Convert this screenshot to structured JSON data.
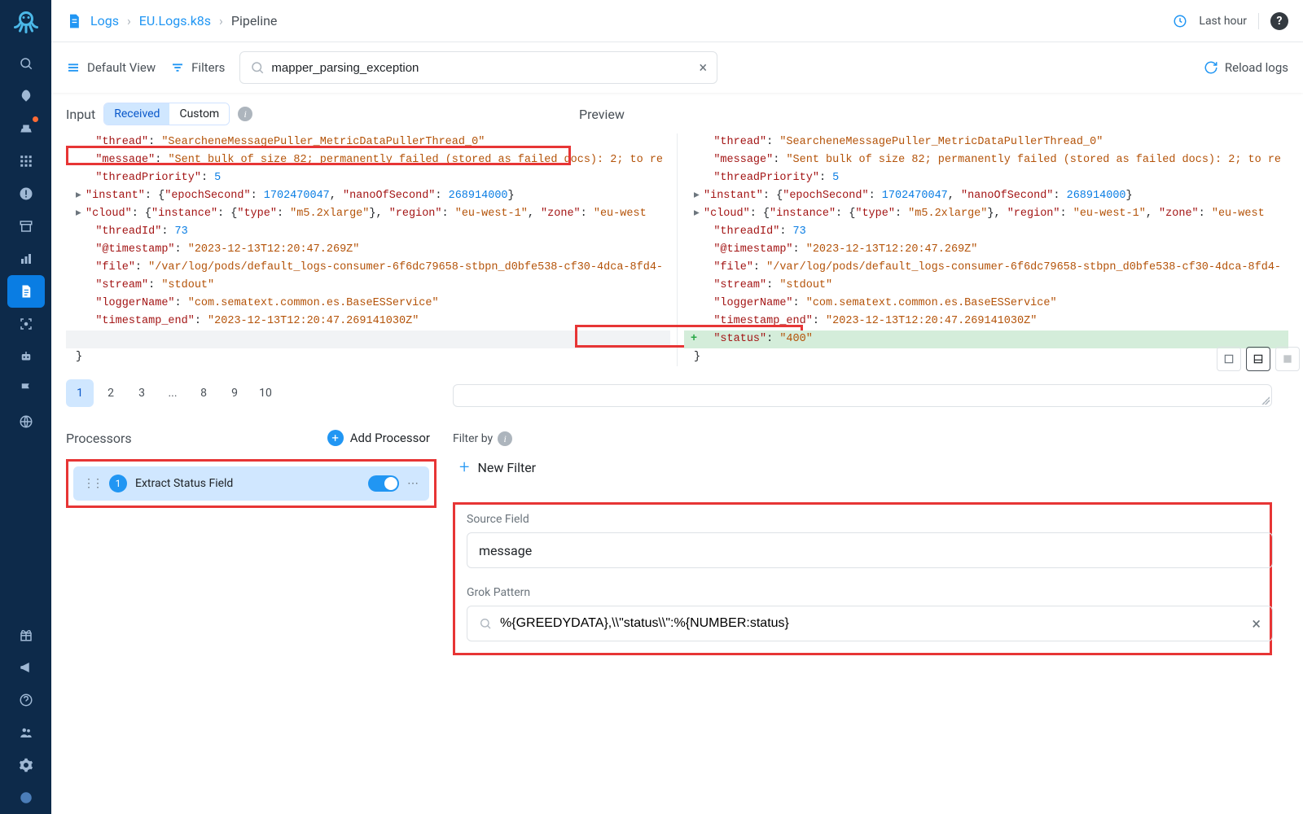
{
  "breadcrumbs": {
    "root": "Logs",
    "app": "EU.Logs.k8s",
    "tab": "Pipeline",
    "time": "Last hour"
  },
  "toolbar": {
    "default_view": "Default View",
    "filters": "Filters",
    "search_value": "mapper_parsing_exception",
    "reload": "Reload logs"
  },
  "panes": {
    "input_title": "Input",
    "received": "Received",
    "custom": "Custom",
    "preview_title": "Preview"
  },
  "json_lines": {
    "thread_key": "\"thread\"",
    "thread_val": "\"SearcheneMessagePuller_MetricDataPullerThread_0\"",
    "message_key": "\"message\"",
    "message_val_left": "\"Sent bulk of size 82; permanently failed (stored as failed docs): 2; to re",
    "message_val_right": "\"Sent bulk of size 82; permanently failed (stored as failed docs): 2; to re",
    "threadPriority_key": "\"threadPriority\"",
    "threadPriority_val": "5",
    "instant_key": "\"instant\"",
    "instant_epoch_key": "\"epochSecond\"",
    "instant_epoch_val": "1702470047",
    "instant_nano_key": "\"nanoOfSecond\"",
    "instant_nano_val": "268914000",
    "cloud_key": "\"cloud\"",
    "cloud_inst_key": "\"instance\"",
    "cloud_type_key": "\"type\"",
    "cloud_type_val": "\"m5.2xlarge\"",
    "cloud_region_key": "\"region\"",
    "cloud_region_val": "\"eu-west-1\"",
    "cloud_zone_key": "\"zone\"",
    "cloud_zone_val_l": "\"eu-west",
    "cloud_zone_val_r": "\"eu-west",
    "threadId_key": "\"threadId\"",
    "threadId_val": "73",
    "ts_key": "\"@timestamp\"",
    "ts_val": "\"2023-12-13T12:20:47.269Z\"",
    "file_key": "\"file\"",
    "file_val_l": "\"/var/log/pods/default_logs-consumer-6f6dc79658-stbpn_d0bfe538-cf30-4dca-8fd4-",
    "file_val_r": "\"/var/log/pods/default_logs-consumer-6f6dc79658-stbpn_d0bfe538-cf30-4dca-8fd4-",
    "stream_key": "\"stream\"",
    "stream_val": "\"stdout\"",
    "logger_key": "\"loggerName\"",
    "logger_val": "\"com.sematext.common.es.BaseESService\"",
    "tse_key": "\"timestamp_end\"",
    "tse_val": "\"2023-12-13T12:20:47.269141030Z\"",
    "status_key": "\"status\"",
    "status_val": "\"400\"",
    "close_brace": "}"
  },
  "pager": [
    "1",
    "2",
    "3",
    "...",
    "8",
    "9",
    "10"
  ],
  "processors": {
    "title": "Processors",
    "add": "Add Processor",
    "item_num": "1",
    "item_name": "Extract Status Field"
  },
  "filter": {
    "label": "Filter by",
    "new_filter": "New Filter"
  },
  "config": {
    "source_label": "Source Field",
    "source_value": "message",
    "grok_label": "Grok Pattern",
    "grok_value": "%{GREEDYDATA},\\\\\"status\\\\\":%{NUMBER:status}"
  }
}
